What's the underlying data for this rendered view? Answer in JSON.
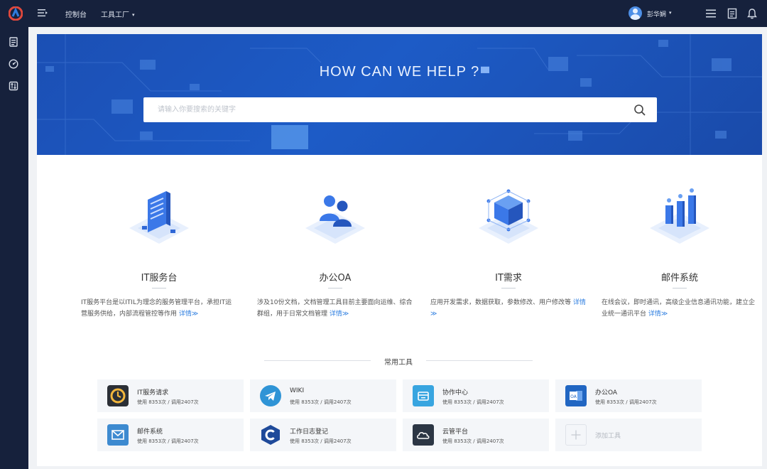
{
  "topbar": {
    "nav": [
      {
        "label": "控制台"
      },
      {
        "label": "工具工厂",
        "caret": "▾"
      }
    ],
    "user": {
      "name": "彭华娴",
      "caret": "▾"
    },
    "icons": [
      "menu-icon",
      "document-icon",
      "bell-icon"
    ]
  },
  "sidebar": {
    "icons": [
      "list-icon",
      "dashboard-icon",
      "transfer-icon"
    ]
  },
  "hero": {
    "title": "HOW CAN WE HELP ?",
    "search_placeholder": "请输入你要搜索的关键字"
  },
  "features": [
    {
      "title": "IT服务台",
      "desc": "IT服务平台是以ITIL为理念的服务管理平台，承担IT运营服务供给，内部流程管控等作用",
      "more": "详情≫",
      "icon": "service-desk-icon"
    },
    {
      "title": "办公OA",
      "desc": "涉及10份文档，文档管理工具目前主要面向运维、综合群组，用于日常文档管理",
      "more": "详情≫",
      "icon": "users-icon"
    },
    {
      "title": "IT需求",
      "desc": "应用开发需求，数据获取，参数修改、用户修改等",
      "more": "详情≫",
      "icon": "cube-icon"
    },
    {
      "title": "邮件系统",
      "desc": "在线会议，即时通讯，高级企业信息通讯功能，建立企业统一通讯平台",
      "more": "详情≫",
      "icon": "bar-chart-icon"
    }
  ],
  "tools_section": {
    "title": "常用工具",
    "items": [
      {
        "name": "IT服务请求",
        "meta": "使用 8353次 / 调用2407次",
        "icon": "it-request-icon",
        "color": "#2b2f36"
      },
      {
        "name": "WIKI",
        "meta": "使用 8353次 / 调用2407次",
        "icon": "telegram-icon",
        "color": "#2f94d6"
      },
      {
        "name": "协作中心",
        "meta": "使用 8353次 / 调用2407次",
        "icon": "collab-icon",
        "color": "#38a5e0"
      },
      {
        "name": "办公OA",
        "meta": "使用 8353次 / 调用2407次",
        "icon": "outlook-icon",
        "color": "#2166c2"
      },
      {
        "name": "邮件系统",
        "meta": "使用 8353次 / 调用2407次",
        "icon": "mail-icon",
        "color": "#3d8ad0"
      },
      {
        "name": "工作日志登记",
        "meta": "使用 8353次 / 调用2407次",
        "icon": "worklog-icon",
        "color": "#1f4a9a"
      },
      {
        "name": "云管平台",
        "meta": "使用 8353次 / 调用2407次",
        "icon": "cloud-icon",
        "color": "#2c3644"
      }
    ],
    "add_label": "添加工具"
  },
  "colors": {
    "topbar": "#16213c",
    "hero": "#1d5bc6",
    "accent": "#2f7fe0"
  }
}
